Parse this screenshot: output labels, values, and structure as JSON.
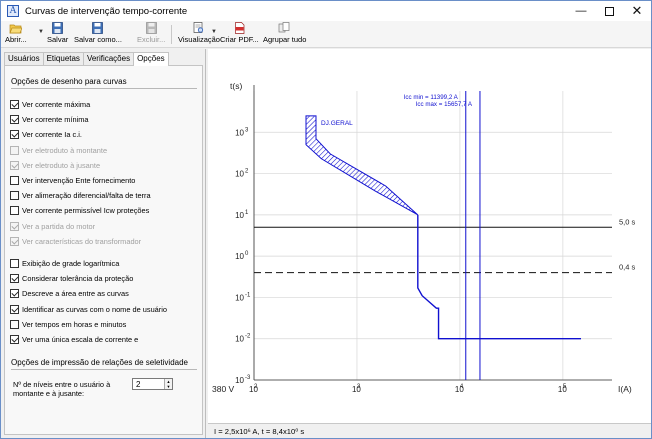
{
  "window": {
    "title": "Curvas de intervenção tempo-corrente",
    "app_icon_letter": "A",
    "controls": [
      "minimize-icon",
      "maximize-icon",
      "close-icon"
    ]
  },
  "toolbar": {
    "open_label": "Abrir...",
    "save_label": "Salvar",
    "save_as_label": "Salvar como...",
    "delete_label": "Excluir...",
    "view_label": "Visualização",
    "pdf_label": "Criar PDF...",
    "group_label": "Agrupar tudo"
  },
  "tabs": [
    {
      "label": "Usuários"
    },
    {
      "label": "Etiquetas"
    },
    {
      "label": "Verificações"
    },
    {
      "label": "Opções",
      "active": true
    }
  ],
  "options": {
    "draw_section": "Opções de desenho para curvas",
    "items": [
      {
        "label": "Ver corrente máxima",
        "checked": true,
        "enabled": true
      },
      {
        "label": "Ver corrente mínima",
        "checked": true,
        "enabled": true
      },
      {
        "label": "Ver corrente Ia c.i.",
        "checked": true,
        "enabled": true
      },
      {
        "label": "Ver eletroduto à montante",
        "checked": false,
        "enabled": false
      },
      {
        "label": "Ver eletroduto à jusante",
        "checked": true,
        "enabled": false
      },
      {
        "label": "Ver intervenção Ente fornecimento",
        "checked": false,
        "enabled": true
      },
      {
        "label": "Ver alimeração diferencial/falta de terra",
        "checked": false,
        "enabled": true
      },
      {
        "label": "Ver corrente permissível Icw proteções",
        "checked": false,
        "enabled": true
      },
      {
        "label": "Ver a partida do motor",
        "checked": true,
        "enabled": false
      },
      {
        "label": "Ver características do transformador",
        "checked": true,
        "enabled": false
      },
      {
        "label": "Exibição de grade logarítmica",
        "checked": false,
        "enabled": true
      },
      {
        "label": "Considerar tolerância da proteção",
        "checked": true,
        "enabled": true
      },
      {
        "label": "Descreve a área entre as curvas",
        "checked": true,
        "enabled": true
      },
      {
        "label": "Identificar as curvas com o nome de usuário",
        "checked": true,
        "enabled": true
      },
      {
        "label": "Ver tempos em horas e minutos",
        "checked": false,
        "enabled": true
      },
      {
        "label": "Ver uma única escala de corrente e",
        "checked": true,
        "enabled": true
      }
    ],
    "print_section": "Opções de impressão de relações de seletividade",
    "levels_label": "Nº de níveis entre o usuário à montante e à jusante:",
    "levels_value": "2"
  },
  "chart_data": {
    "type": "line",
    "ylabel": "t(s)",
    "xlabel": "I(A)",
    "voltage_label": "380 V",
    "x_scale": "log",
    "y_scale": "log",
    "xlim": [
      100,
      300000
    ],
    "ylim": [
      0.001,
      10000
    ],
    "x_ticks": [
      {
        "value": 100,
        "base": "10",
        "exp": "2"
      },
      {
        "value": 1000,
        "base": "10",
        "exp": "3"
      },
      {
        "value": 10000,
        "base": "10",
        "exp": "4"
      },
      {
        "value": 100000,
        "base": "10",
        "exp": "5"
      }
    ],
    "y_ticks": [
      {
        "value": 1000,
        "base": "10",
        "exp": "3"
      },
      {
        "value": 100,
        "base": "10",
        "exp": "2"
      },
      {
        "value": 10,
        "base": "10",
        "exp": "1"
      },
      {
        "value": 1,
        "base": "10",
        "exp": "0"
      },
      {
        "value": 0.1,
        "base": "10",
        "exp": "-1"
      },
      {
        "value": 0.01,
        "base": "10",
        "exp": "-2"
      },
      {
        "value": 0.001,
        "base": "10",
        "exp": "-3"
      }
    ],
    "grid": true,
    "curve_name": "DJ.GERAL",
    "curve_color": "#1010d0",
    "band_min": [
      [
        320,
        2500
      ],
      [
        320,
        500
      ],
      [
        450,
        230
      ],
      [
        1500,
        38
      ],
      [
        3900,
        10
      ]
    ],
    "band_max": [
      [
        400,
        2500
      ],
      [
        400,
        700
      ],
      [
        550,
        300
      ],
      [
        1900,
        50
      ],
      [
        3900,
        10
      ]
    ],
    "trip_curve": [
      [
        3900,
        10
      ],
      [
        3900,
        0.17
      ],
      [
        4300,
        0.11
      ],
      [
        5900,
        0.055
      ],
      [
        6200,
        0.055
      ],
      [
        6200,
        0.01
      ],
      [
        150000,
        0.01
      ]
    ],
    "current_lines": [
      {
        "value": 11399.2,
        "label": "Icc min = 11399,2 A",
        "color": "#1010d0"
      },
      {
        "value": 15657.7,
        "label": "Icc max = 15657,7 A",
        "color": "#1010d0"
      }
    ],
    "time_lines": [
      {
        "value": 5.0,
        "label": "5,0 s",
        "style": "solid"
      },
      {
        "value": 0.4,
        "label": "0,4 s",
        "style": "dashed"
      }
    ]
  },
  "status": {
    "text": "I = 2,5x10⁶ A,  t = 8,4x10⁰ s"
  }
}
